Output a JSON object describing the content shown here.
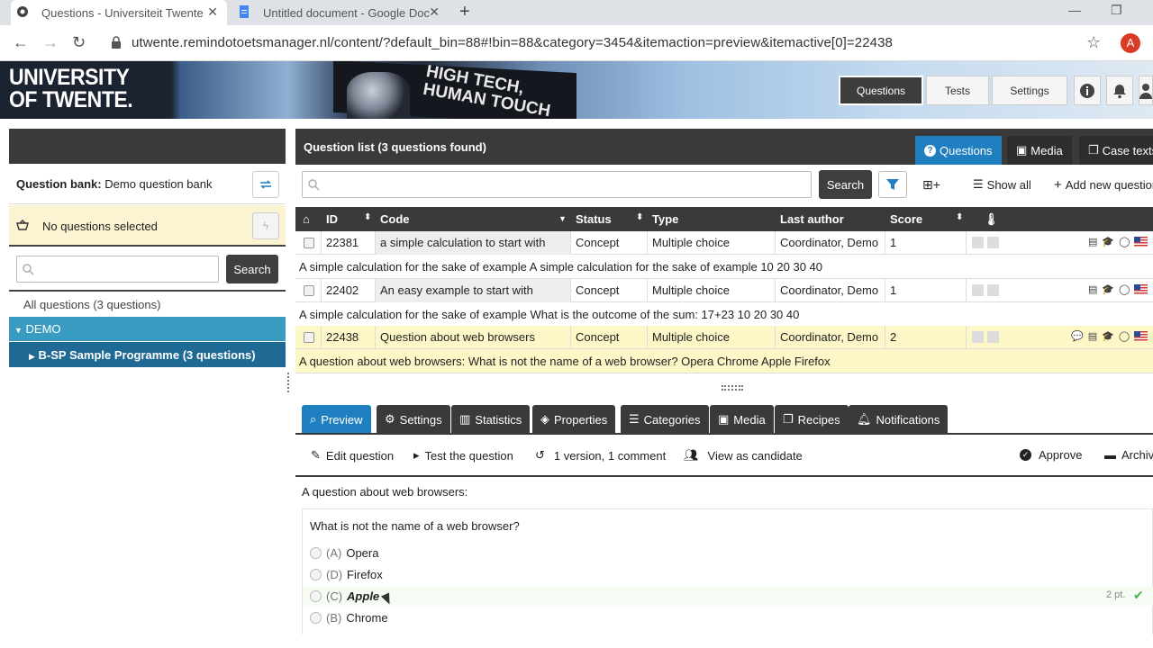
{
  "browser": {
    "tabs": [
      {
        "title": "Questions - Universiteit Twente"
      },
      {
        "title": "Untitled document - Google Doc"
      }
    ],
    "url": "utwente.remindotoetsmanager.nl/content/?default_bin=88#!bin=88&category=3454&itemaction=preview&itemactive[0]=22438",
    "avatar_letter": "A"
  },
  "header": {
    "logo_line1": "UNIVERSITY",
    "logo_line2": "OF TWENTE.",
    "banner_line1": "HIGH TECH,",
    "banner_line2": "HUMAN TOUCH",
    "nav": {
      "questions": "Questions",
      "tests": "Tests",
      "settings": "Settings"
    }
  },
  "left_panel": {
    "qbank_label": "Question bank:",
    "qbank_value": "Demo question bank",
    "basket_text": "No questions selected",
    "search_button": "Search",
    "all_questions": "All questions (3 questions)",
    "tree": {
      "root": "DEMO",
      "child": "B-SP Sample Programme (3 questions)"
    }
  },
  "question_list": {
    "title": "Question list  (3 questions found)",
    "tabs": {
      "questions": "Questions",
      "media": "Media",
      "case_texts": "Case texts"
    },
    "search_button": "Search",
    "show_all": "Show all",
    "add_new": "Add new question",
    "columns": {
      "id": "ID",
      "code": "Code",
      "status": "Status",
      "type": "Type",
      "author": "Last author",
      "score": "Score"
    },
    "rows": [
      {
        "id": "22381",
        "code": "a simple calculation to start with",
        "status": "Concept",
        "type": "Multiple choice",
        "author": "Coordinator, Demo",
        "score": "1",
        "desc": "A simple calculation for the sake of example A simple calculation for the sake of example 10 20 30 40"
      },
      {
        "id": "22402",
        "code": "An easy example to start with",
        "status": "Concept",
        "type": "Multiple choice",
        "author": "Coordinator, Demo",
        "score": "1",
        "desc": "A simple calculation for the sake of example What is the outcome of the sum: 17+23 10 20 30 40"
      },
      {
        "id": "22438",
        "code": "Question about web browsers",
        "status": "Concept",
        "type": "Multiple choice",
        "author": "Coordinator, Demo",
        "score": "2",
        "desc": "A question about web browsers: What is not the name of a web browser? Opera Chrome Apple Firefox"
      }
    ]
  },
  "detail_tabs": {
    "preview": "Preview",
    "settings": "Settings",
    "statistics": "Statistics",
    "properties": "Properties",
    "categories": "Categories",
    "media": "Media",
    "recipes": "Recipes",
    "notifications": "Notifications"
  },
  "actions": {
    "edit": "Edit question",
    "test": "Test the question",
    "versions": "1 version, 1 comment",
    "view_candidate": "View as candidate",
    "approve": "Approve",
    "archive": "Archive"
  },
  "preview": {
    "intro": "A question about web browsers:",
    "stem": "What is not the name of a web browser?",
    "options": [
      {
        "letter": "(A)",
        "text": "Opera"
      },
      {
        "letter": "(D)",
        "text": "Firefox"
      },
      {
        "letter": "(C)",
        "text": "Apple"
      },
      {
        "letter": "(B)",
        "text": "Chrome"
      }
    ],
    "points": "2 pt."
  }
}
